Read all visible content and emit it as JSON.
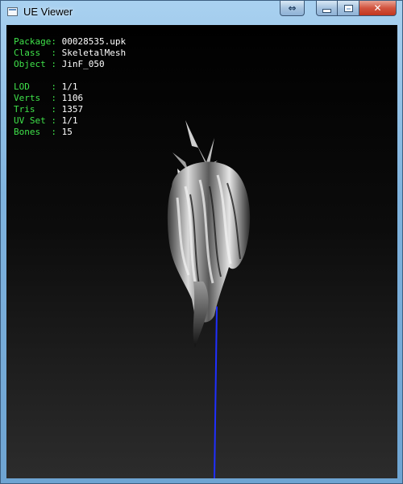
{
  "window": {
    "title": "UE Viewer",
    "controls": {
      "swap_icon": "swap-arrows-icon",
      "minimize_icon": "minimize-icon",
      "maximize_icon": "maximize-icon",
      "close_icon": "close-icon"
    }
  },
  "info": {
    "package": {
      "label": "Package:",
      "value": "00028535.upk"
    },
    "class": {
      "label": "Class  :",
      "value": "SkeletalMesh"
    },
    "object": {
      "label": "Object :",
      "value": "JinF_050"
    },
    "lod": {
      "label": "LOD    :",
      "value": "1/1"
    },
    "verts": {
      "label": "Verts  :",
      "value": "1106"
    },
    "tris": {
      "label": "Tris   :",
      "value": "1357"
    },
    "uvset": {
      "label": "UV Set :",
      "value": "1/1"
    },
    "bones": {
      "label": "Bones  :",
      "value": "15"
    }
  },
  "colors": {
    "label": "#3fe24a",
    "value": "#ffffff",
    "axis": "#1f2fff"
  }
}
